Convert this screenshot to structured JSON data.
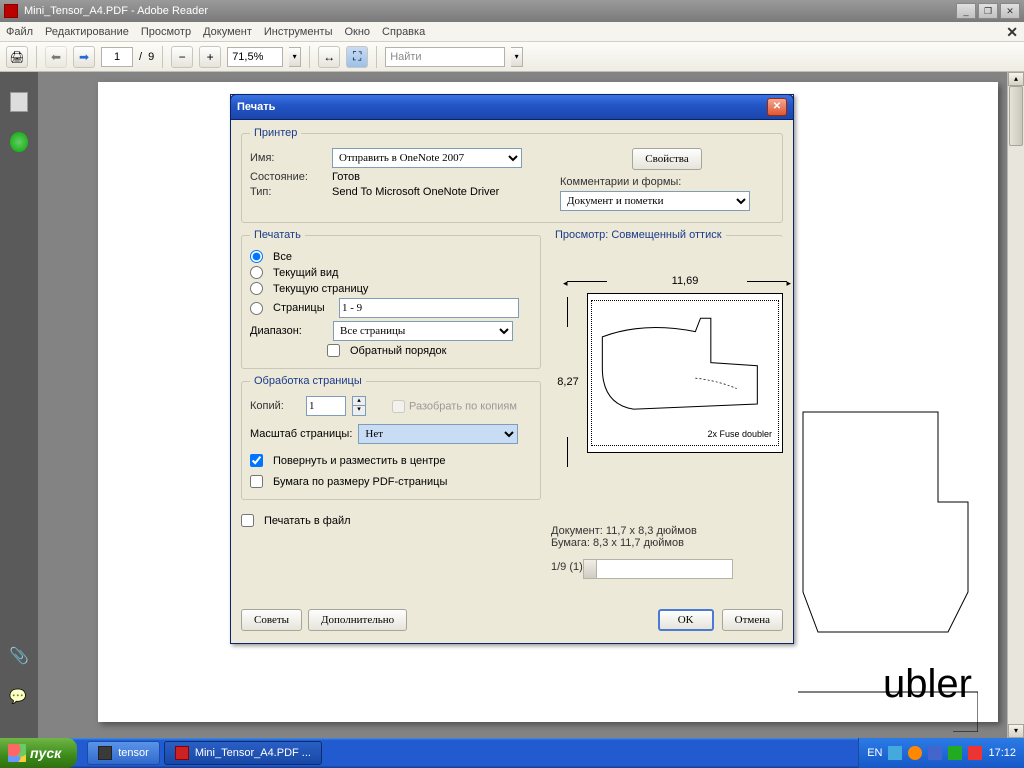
{
  "window": {
    "title": "Mini_Tensor_A4.PDF - Adobe Reader"
  },
  "menu": {
    "file": "Файл",
    "edit": "Редактирование",
    "view": "Просмотр",
    "document": "Документ",
    "tools": "Инструменты",
    "window": "Окно",
    "help": "Справка"
  },
  "toolbar": {
    "page_current": "1",
    "page_sep": "/",
    "page_total": "9",
    "zoom": "71,5%",
    "find_placeholder": "Найти"
  },
  "page_content": {
    "big_label": "ubler"
  },
  "dialog": {
    "title": "Печать",
    "printer_group": "Принтер",
    "name_label": "Имя:",
    "name_value": "Отправить в OneNote 2007",
    "properties_btn": "Свойства",
    "status_label": "Состояние:",
    "status_value": "Готов",
    "type_label": "Тип:",
    "type_value": "Send To Microsoft OneNote Driver",
    "comments_label": "Комментарии и формы:",
    "comments_value": "Документ и пометки",
    "range_group": "Печатать",
    "range_all": "Все",
    "range_view": "Текущий вид",
    "range_page": "Текущую страницу",
    "range_pages": "Страницы",
    "range_pages_value": "1 - 9",
    "range_subset_label": "Диапазон:",
    "range_subset_value": "Все страницы",
    "reverse": "Обратный порядок",
    "handling_group": "Обработка страницы",
    "copies_label": "Копий:",
    "copies_value": "1",
    "collate": "Разобрать по копиям",
    "scaling_label": "Масштаб страницы:",
    "scaling_value": "Нет",
    "autorotate": "Повернуть и разместить в центре",
    "paper_by_pdf": "Бумага по размеру PDF-страницы",
    "print_to_file": "Печатать в файл",
    "preview_label": "Просмотр: Совмещенный оттиск",
    "preview_w": "11,69",
    "preview_h": "8,27",
    "preview_annot": "2x Fuse doubler",
    "info_doc": "Документ: 11,7 x 8,3 дюймов",
    "info_paper": "Бумага: 8,3 x 11,7 дюймов",
    "info_sheets": "1/9 (1)",
    "tips_btn": "Советы",
    "advanced_btn": "Дополнительно",
    "ok_btn": "OK",
    "cancel_btn": "Отмена"
  },
  "taskbar": {
    "start": "пуск",
    "app1": "tensor",
    "app2": "Mini_Tensor_A4.PDF ...",
    "lang": "EN",
    "clock": "17:12"
  }
}
